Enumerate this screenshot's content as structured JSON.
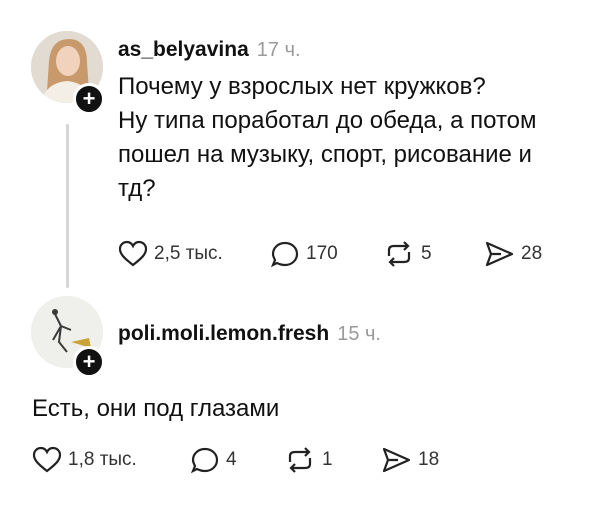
{
  "posts": [
    {
      "username": "as_belyavina",
      "time": "17 ч.",
      "text_lines": [
        "Почему у взрослых нет кружков?",
        "Ну типа поработал до обеда, а потом",
        "пошел на музыку, спорт, рисование и",
        "тд?"
      ],
      "likes": "2,5 тыс.",
      "comments": "170",
      "reposts": "5",
      "shares": "28"
    },
    {
      "username": "poli.moli.lemon.fresh",
      "time": "15 ч.",
      "text_lines": [
        "Есть, они под глазами"
      ],
      "likes": "1,8 тыс.",
      "comments": "4",
      "reposts": "1",
      "shares": "18"
    }
  ],
  "icons": {
    "like": "heart-icon",
    "comment": "comment-icon",
    "repost": "repost-icon",
    "share": "share-icon",
    "follow": "plus-icon"
  },
  "colors": {
    "text": "#111111",
    "muted": "#9a9a9a",
    "thread_line": "#d6d6d6"
  }
}
